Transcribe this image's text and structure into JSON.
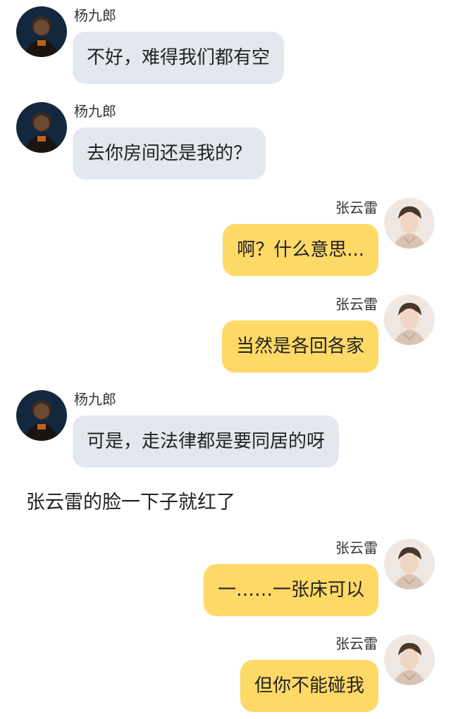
{
  "messages": [
    {
      "sender": "杨九郎",
      "text": "不好，难得我们都有空"
    },
    {
      "sender": "杨九郎",
      "text": "去你房间还是我的？"
    },
    {
      "sender": "张云雷",
      "text": "啊？什么意思..."
    },
    {
      "sender": "张云雷",
      "text": "当然是各回各家"
    },
    {
      "sender": "杨九郎",
      "text": "可是，走法律都是要同居的呀"
    },
    {
      "sender": "张云雷",
      "text": "一……一张床可以"
    },
    {
      "sender": "张云雷",
      "text": "但你不能碰我"
    }
  ],
  "narration": "张云雷的脸一下子就红了",
  "colors": {
    "left_bubble": "#e3e8ef",
    "right_bubble": "#ffd966",
    "background": "#ffffff"
  },
  "icons": {
    "left_avatar": "dark-portrait-avatar",
    "right_avatar": "light-portrait-avatar"
  }
}
